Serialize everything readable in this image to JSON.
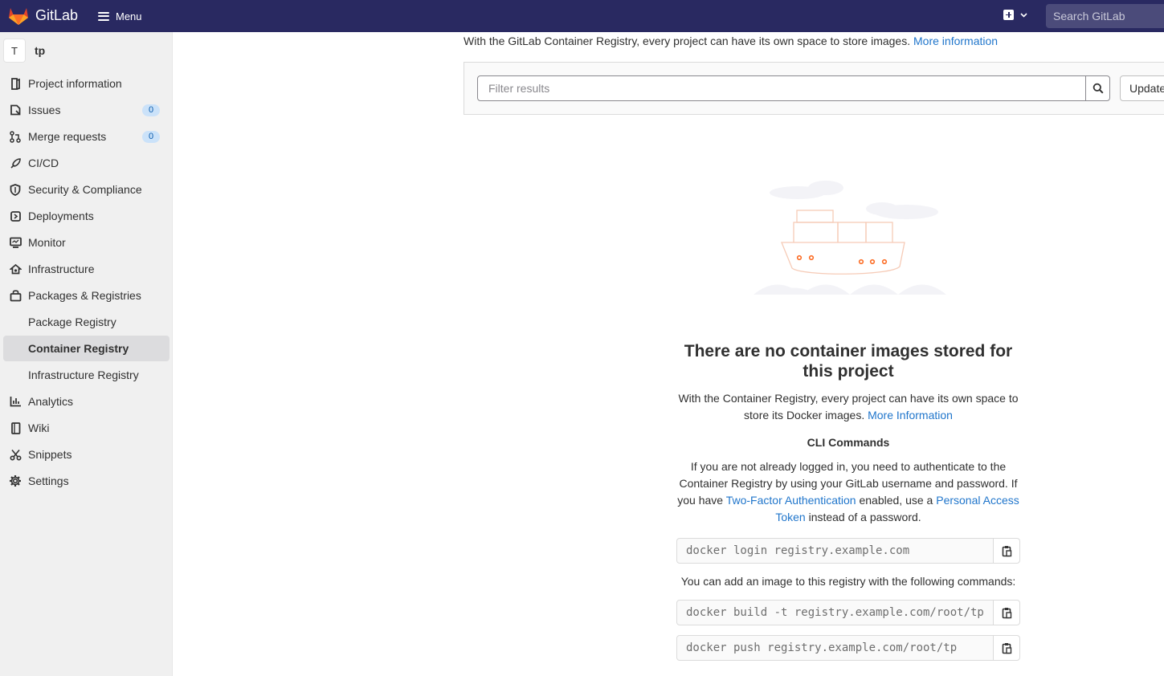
{
  "navbar": {
    "brand": "GitLab",
    "menu_label": "Menu",
    "new_icon": "plus-square-icon",
    "search_placeholder": "Search GitLab",
    "bg_color": "#292961"
  },
  "sidebar": {
    "project": {
      "avatar_letter": "T",
      "name": "tp"
    },
    "items": [
      {
        "label": "Project information",
        "icon": "project-icon"
      },
      {
        "label": "Issues",
        "icon": "issues-icon",
        "count": "0"
      },
      {
        "label": "Merge requests",
        "icon": "merge-request-icon",
        "count": "0"
      },
      {
        "label": "CI/CD",
        "icon": "rocket-icon"
      },
      {
        "label": "Security & Compliance",
        "icon": "shield-icon"
      },
      {
        "label": "Deployments",
        "icon": "deployments-icon"
      },
      {
        "label": "Monitor",
        "icon": "monitor-icon"
      },
      {
        "label": "Infrastructure",
        "icon": "cloud-icon"
      },
      {
        "label": "Packages & Registries",
        "icon": "package-icon"
      },
      {
        "label": "Package Registry"
      },
      {
        "label": "Container Registry",
        "active": true
      },
      {
        "label": "Infrastructure Registry"
      },
      {
        "label": "Analytics",
        "icon": "chart-icon"
      },
      {
        "label": "Wiki",
        "icon": "book-icon"
      },
      {
        "label": "Snippets",
        "icon": "scissors-icon"
      },
      {
        "label": "Settings",
        "icon": "gear-icon"
      }
    ]
  },
  "main": {
    "intro_text": "With the GitLab Container Registry, every project can have its own space to store images.",
    "intro_link": "More information",
    "filter": {
      "placeholder": "Filter results",
      "update_label": "Update"
    },
    "empty_state": {
      "title": "There are no container images stored for this project",
      "description": "With the Container Registry, every project can have its own space to store its Docker images.",
      "description_link": "More Information",
      "cli_heading": "CLI Commands",
      "cli_note_1": "If you are not already logged in, you need to authenticate to the Container Registry by using your GitLab username and password. If you have",
      "cli_note_link1": "Two-Factor Authentication",
      "cli_note_2": "enabled, use a",
      "cli_note_link2": "Personal Access Token",
      "cli_note_3": "instead of a password.",
      "login_cmd": "docker login registry.example.com",
      "add_note": "You can add an image to this registry with the following commands:",
      "build_cmd": "docker build -t registry.example.com/root/tp .",
      "push_cmd": "docker push registry.example.com/root/tp"
    }
  },
  "colors": {
    "link": "#1f75cb",
    "active_item_bg": "#dcdcde",
    "badge_bg": "#cbe2f9"
  }
}
